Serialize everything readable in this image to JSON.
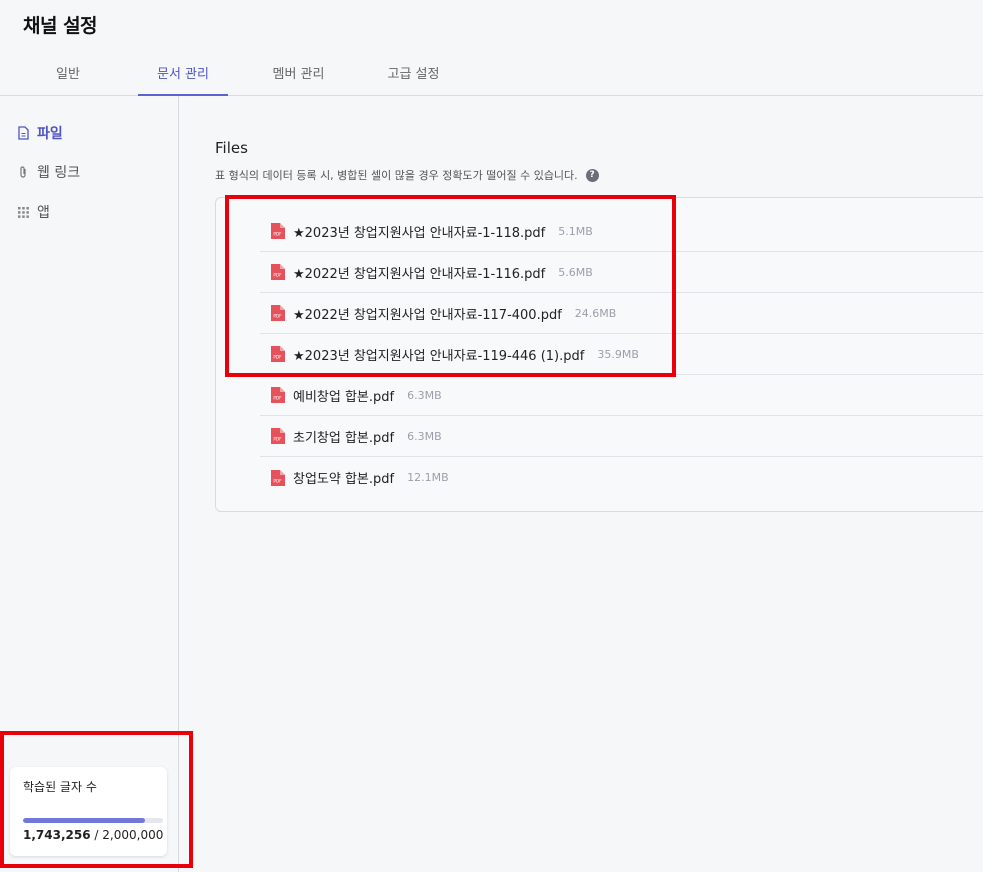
{
  "page": {
    "title": "채널 설정"
  },
  "tabs": [
    {
      "label": "일반",
      "active": false
    },
    {
      "label": "문서 관리",
      "active": true
    },
    {
      "label": "멤버 관리",
      "active": false
    },
    {
      "label": "고급 설정",
      "active": false
    }
  ],
  "sidebar": {
    "items": [
      {
        "label": "파일",
        "icon": "file-icon",
        "active": true
      },
      {
        "label": "웹 링크",
        "icon": "paperclip-icon",
        "active": false
      },
      {
        "label": "앱",
        "icon": "grid-icon",
        "active": false
      }
    ],
    "usage": {
      "label": "학습된 글자 수",
      "used": "1,743,256",
      "separator": "/",
      "total": "2,000,000",
      "fraction": 0.8716
    }
  },
  "files_section": {
    "title": "Files",
    "description": "표 형식의 데이터 등록 시, 병합된 셀이 많을 경우 정확도가 떨어질 수 있습니다.",
    "help_icon": "question-circle-icon",
    "files": [
      {
        "name": "★2023년 창업지원사업 안내자료-1-118.pdf",
        "size": "5.1MB"
      },
      {
        "name": "★2022년 창업지원사업 안내자료-1-116.pdf",
        "size": "5.6MB"
      },
      {
        "name": "★2022년 창업지원사업 안내자료-117-400.pdf",
        "size": "24.6MB"
      },
      {
        "name": "★2023년 창업지원사업 안내자료-119-446 (1).pdf",
        "size": "35.9MB"
      },
      {
        "name": "예비창업 합본.pdf",
        "size": "6.3MB"
      },
      {
        "name": "초기창업 합본.pdf",
        "size": "6.3MB"
      },
      {
        "name": "창업도약 합본.pdf",
        "size": "12.1MB"
      }
    ]
  },
  "colors": {
    "accent": "#4d55c9",
    "progress": "#7278d8",
    "highlight_box": "#e8000b",
    "pdf_icon": "#e5525c"
  }
}
